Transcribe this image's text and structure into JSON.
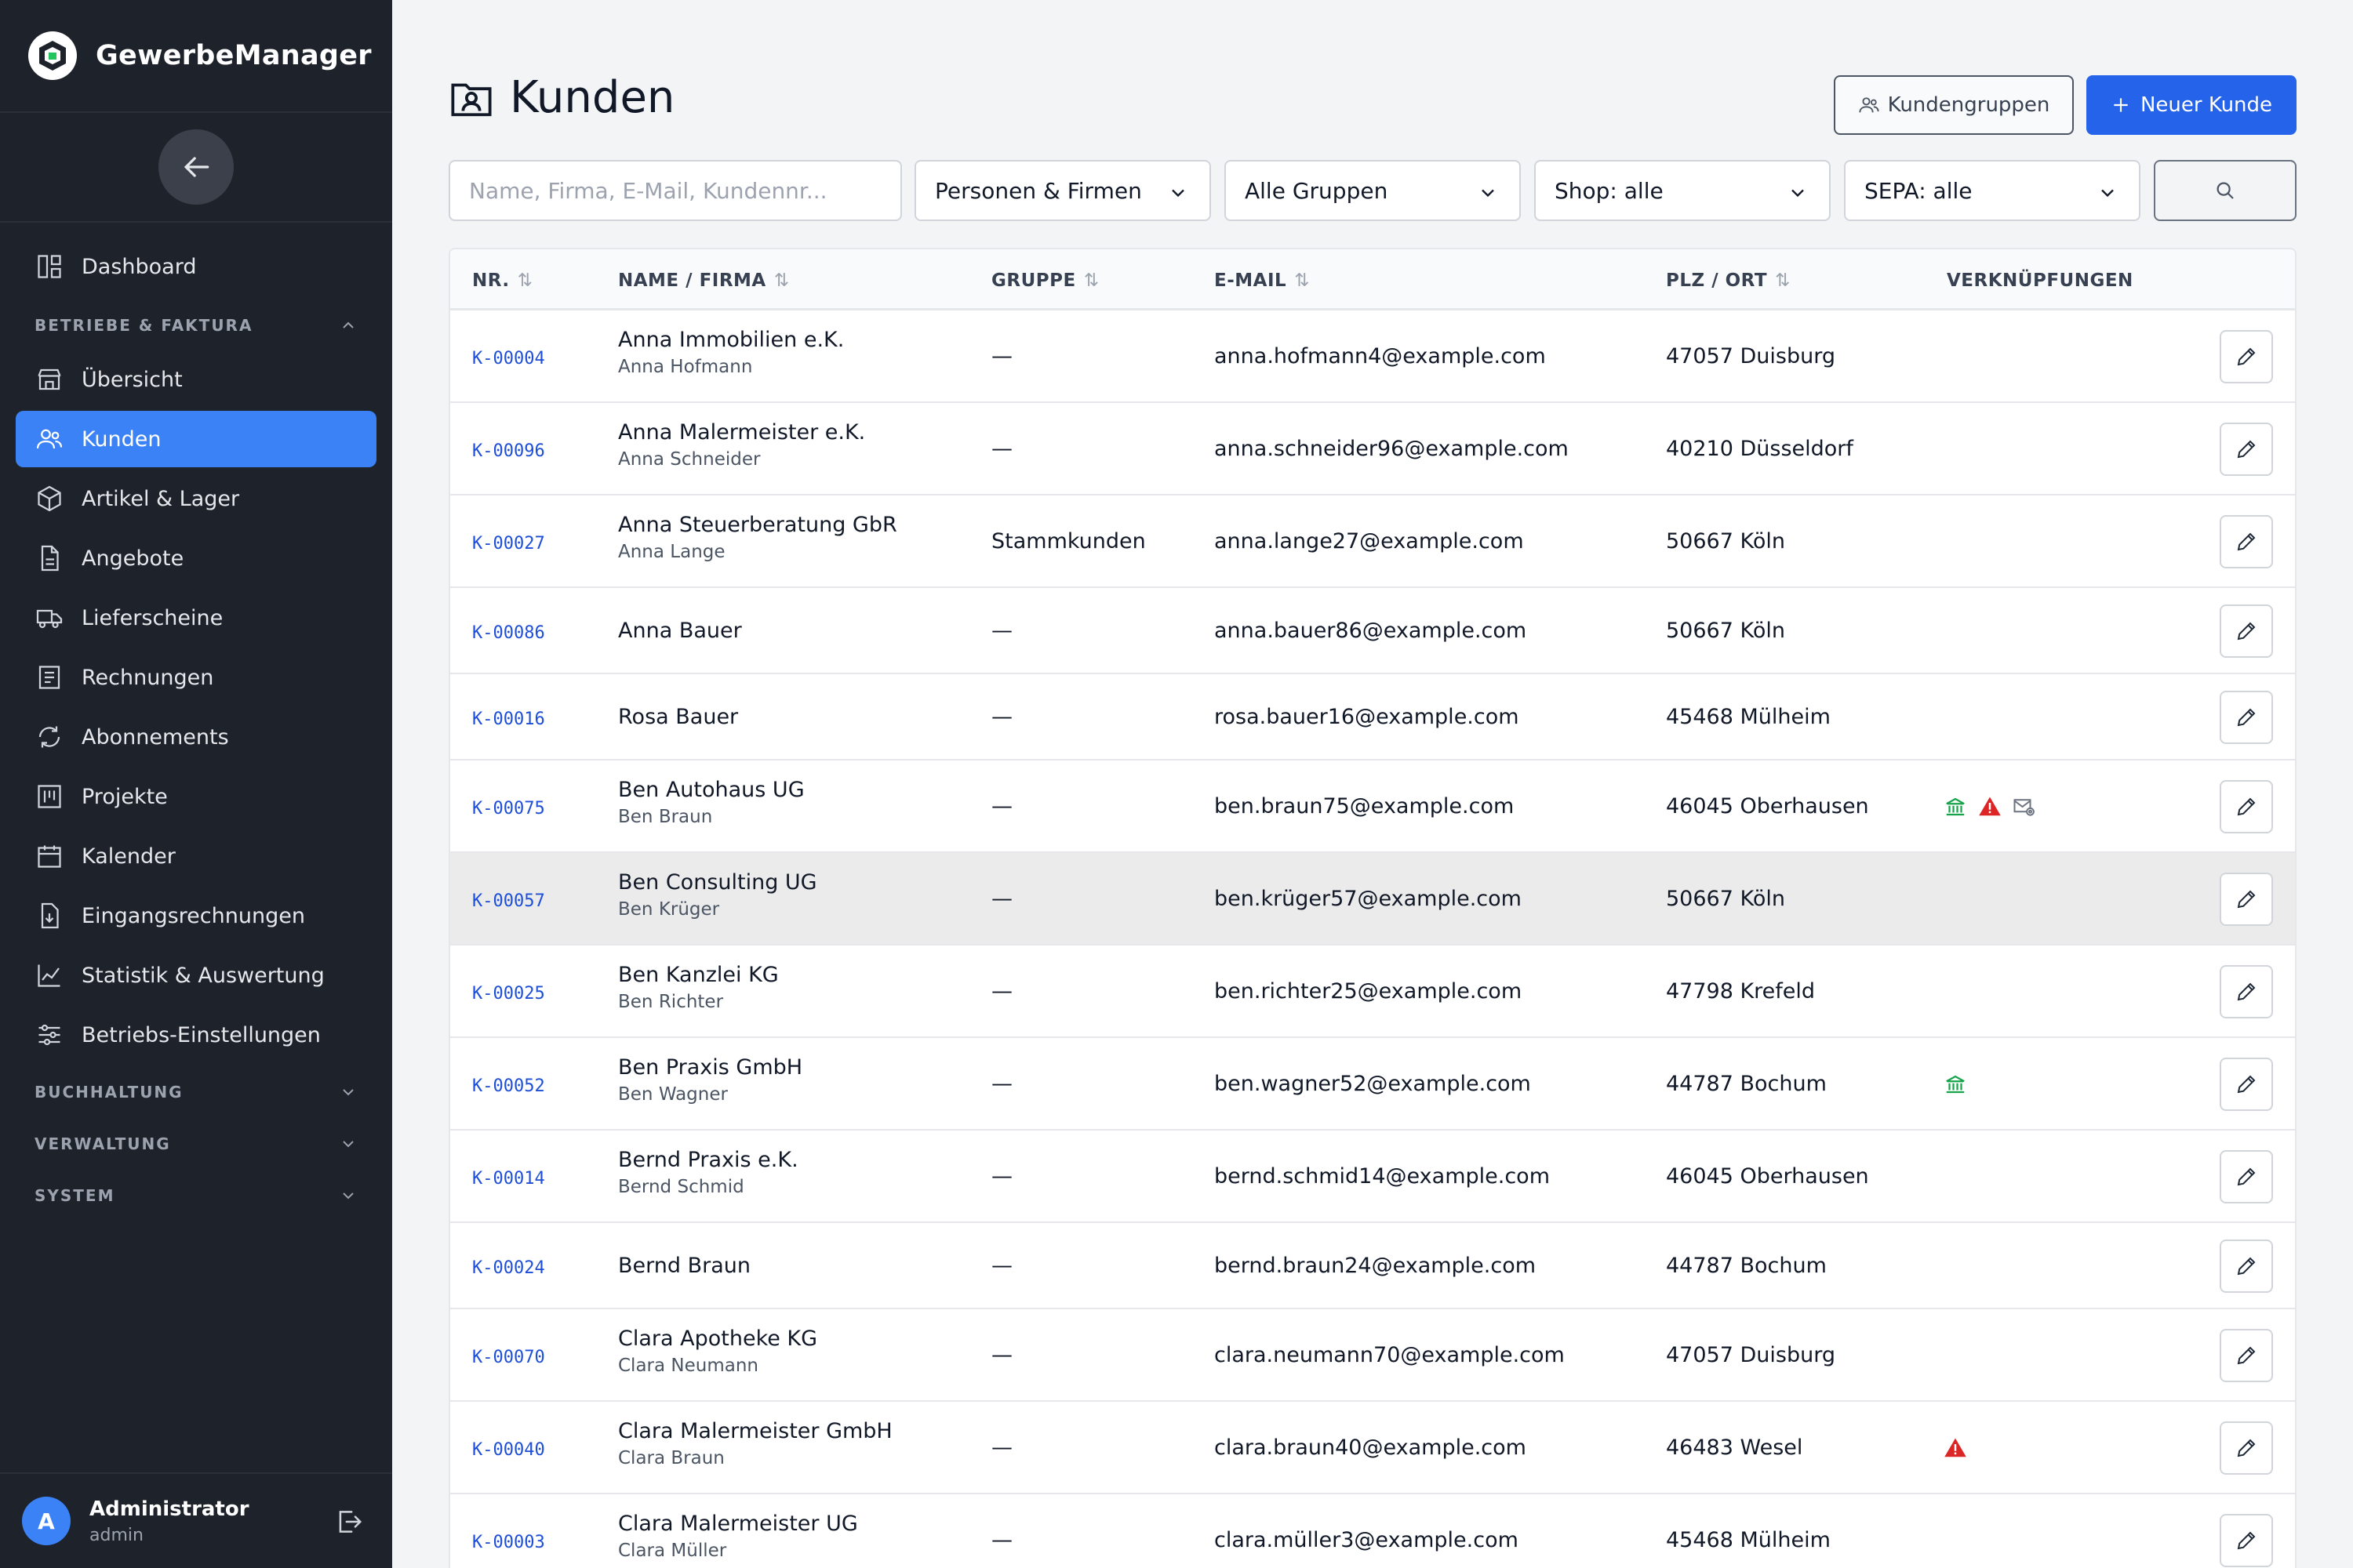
{
  "app": {
    "name": "GewerbeManager"
  },
  "sidebar": {
    "items_top": [
      {
        "label": "Dashboard",
        "icon": "dashboard-icon"
      }
    ],
    "section_betriebe": "BETRIEBE & FAKTURA",
    "items": [
      {
        "label": "Übersicht",
        "icon": "store-icon"
      },
      {
        "label": "Kunden",
        "icon": "users-icon",
        "active": true
      },
      {
        "label": "Artikel & Lager",
        "icon": "box-icon"
      },
      {
        "label": "Angebote",
        "icon": "document-icon"
      },
      {
        "label": "Lieferscheine",
        "icon": "truck-icon"
      },
      {
        "label": "Rechnungen",
        "icon": "invoice-icon"
      },
      {
        "label": "Abonnements",
        "icon": "refresh-icon"
      },
      {
        "label": "Projekte",
        "icon": "kanban-icon"
      },
      {
        "label": "Kalender",
        "icon": "calendar-icon"
      },
      {
        "label": "Eingangsrechnungen",
        "icon": "inbox-document-icon"
      },
      {
        "label": "Statistik & Auswertung",
        "icon": "chart-icon"
      },
      {
        "label": "Betriebs-Einstellungen",
        "icon": "sliders-icon"
      }
    ],
    "sections": [
      "BUCHHALTUNG",
      "VERWALTUNG",
      "SYSTEM"
    ],
    "user": {
      "initial": "A",
      "name": "Administrator",
      "role": "admin"
    }
  },
  "page": {
    "title": "Kunden",
    "btn_groups": "Kundengruppen",
    "btn_new": "Neuer Kunde"
  },
  "filters": {
    "search_placeholder": "Name, Firma, E-Mail, Kundennr...",
    "type": "Personen & Firmen",
    "group": "Alle Gruppen",
    "shop": "Shop: alle",
    "sepa": "SEPA: alle"
  },
  "table": {
    "headers": {
      "nr": "NR.",
      "name": "NAME / FIRMA",
      "group": "GRUPPE",
      "email": "E-MAIL",
      "city": "PLZ / ORT",
      "links": "VERKNÜPFUNGEN"
    },
    "rows": [
      {
        "nr": "K-00004",
        "name": "Anna Immobilien e.K.",
        "contact": "Anna Hofmann",
        "group": "—",
        "email": "anna.hofmann4@example.com",
        "city": "47057 Duisburg",
        "links": []
      },
      {
        "nr": "K-00096",
        "name": "Anna Malermeister e.K.",
        "contact": "Anna Schneider",
        "group": "—",
        "email": "anna.schneider96@example.com",
        "city": "40210 Düsseldorf",
        "links": []
      },
      {
        "nr": "K-00027",
        "name": "Anna Steuerberatung GbR",
        "contact": "Anna Lange",
        "group": "Stammkunden",
        "email": "anna.lange27@example.com",
        "city": "50667 Köln",
        "links": []
      },
      {
        "nr": "K-00086",
        "name": "Anna Bauer",
        "contact": "",
        "group": "—",
        "email": "anna.bauer86@example.com",
        "city": "50667 Köln",
        "links": []
      },
      {
        "nr": "K-00016",
        "name": "Rosa Bauer",
        "contact": "",
        "group": "—",
        "email": "rosa.bauer16@example.com",
        "city": "45468 Mülheim",
        "links": []
      },
      {
        "nr": "K-00075",
        "name": "Ben Autohaus UG",
        "contact": "Ben Braun",
        "group": "—",
        "email": "ben.braun75@example.com",
        "city": "46045 Oberhausen",
        "links": [
          "bank-icon",
          "warning-icon",
          "mail-settings-icon"
        ]
      },
      {
        "nr": "K-00057",
        "name": "Ben Consulting UG",
        "contact": "Ben Krüger",
        "group": "—",
        "email": "ben.krüger57@example.com",
        "city": "50667 Köln",
        "links": [],
        "highlight": true
      },
      {
        "nr": "K-00025",
        "name": "Ben Kanzlei KG",
        "contact": "Ben Richter",
        "group": "—",
        "email": "ben.richter25@example.com",
        "city": "47798 Krefeld",
        "links": []
      },
      {
        "nr": "K-00052",
        "name": "Ben Praxis GmbH",
        "contact": "Ben Wagner",
        "group": "—",
        "email": "ben.wagner52@example.com",
        "city": "44787 Bochum",
        "links": [
          "bank-icon"
        ]
      },
      {
        "nr": "K-00014",
        "name": "Bernd Praxis e.K.",
        "contact": "Bernd Schmid",
        "group": "—",
        "email": "bernd.schmid14@example.com",
        "city": "46045 Oberhausen",
        "links": []
      },
      {
        "nr": "K-00024",
        "name": "Bernd Braun",
        "contact": "",
        "group": "—",
        "email": "bernd.braun24@example.com",
        "city": "44787 Bochum",
        "links": []
      },
      {
        "nr": "K-00070",
        "name": "Clara Apotheke KG",
        "contact": "Clara Neumann",
        "group": "—",
        "email": "clara.neumann70@example.com",
        "city": "47057 Duisburg",
        "links": []
      },
      {
        "nr": "K-00040",
        "name": "Clara Malermeister GmbH",
        "contact": "Clara Braun",
        "group": "—",
        "email": "clara.braun40@example.com",
        "city": "46483 Wesel",
        "links": [
          "warning-icon"
        ]
      },
      {
        "nr": "K-00003",
        "name": "Clara Malermeister UG",
        "contact": "Clara Müller",
        "group": "—",
        "email": "clara.müller3@example.com",
        "city": "45468 Mülheim",
        "links": []
      }
    ]
  },
  "colors": {
    "sidebar": "#1e222b",
    "accent": "#3b82f6",
    "primary_button": "#2563eb",
    "bank": "#16a34a",
    "warning": "#dc2626",
    "link_id": "#1d4ed8"
  }
}
